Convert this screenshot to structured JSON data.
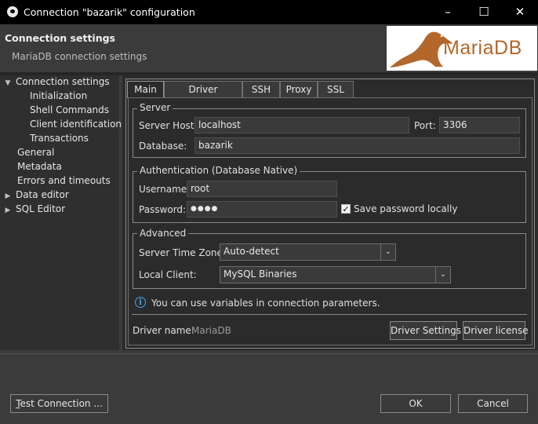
{
  "window": {
    "title": "Connection \"bazarik\" configuration",
    "minimize": "–",
    "maximize": "☐",
    "close": "✕"
  },
  "header": {
    "title": "Connection settings",
    "subtitle": "MariaDB connection settings",
    "logo_text": "MariaDB"
  },
  "tree": {
    "items": [
      {
        "label": "Connection settings",
        "expanded": true,
        "level": 0
      },
      {
        "label": "Initialization",
        "level": 1
      },
      {
        "label": "Shell Commands",
        "level": 1
      },
      {
        "label": "Client identification",
        "level": 1
      },
      {
        "label": "Transactions",
        "level": 1
      },
      {
        "label": "General",
        "level": 0
      },
      {
        "label": "Metadata",
        "level": 0
      },
      {
        "label": "Errors and timeouts",
        "level": 0
      },
      {
        "label": "Data editor",
        "collapsed": true,
        "level": 0
      },
      {
        "label": "SQL Editor",
        "collapsed": true,
        "level": 0
      }
    ]
  },
  "tabs": [
    "Main",
    "Driver properties",
    "SSH",
    "Proxy",
    "SSL"
  ],
  "server": {
    "group_label": "Server",
    "host_label": "Server Host:",
    "host_value": "localhost",
    "port_label": "Port:",
    "port_value": "3306",
    "database_label": "Database:",
    "database_value": "bazarik"
  },
  "auth": {
    "group_label": "Authentication (Database Native)",
    "username_label": "Username:",
    "username_value": "root",
    "password_label": "Password:",
    "password_value": "●●●●",
    "save_password_label": "Save password locally",
    "save_password_checked": true
  },
  "advanced": {
    "group_label": "Advanced",
    "timezone_label": "Server Time Zone:",
    "timezone_value": "Auto-detect",
    "local_client_label": "Local Client:",
    "local_client_value": "MySQL Binaries"
  },
  "info_text": "You can use variables in connection parameters.",
  "driver": {
    "name_label": "Driver name:",
    "name_value": "MariaDB",
    "settings_button": "Driver Settings",
    "license_button": "Driver license"
  },
  "footer": {
    "test_connection_underline": "T",
    "test_connection_rest": "est Connection ...",
    "ok_button": "OK",
    "cancel_button": "Cancel"
  },
  "icons": {
    "info": "info-icon",
    "dropdown": "chevron-down-icon",
    "tree_expanded": "chevron-down-icon",
    "tree_collapsed": "chevron-right-icon"
  },
  "colors": {
    "logo_brand": "#b3672a",
    "info_blue": "#4aa0e6"
  }
}
